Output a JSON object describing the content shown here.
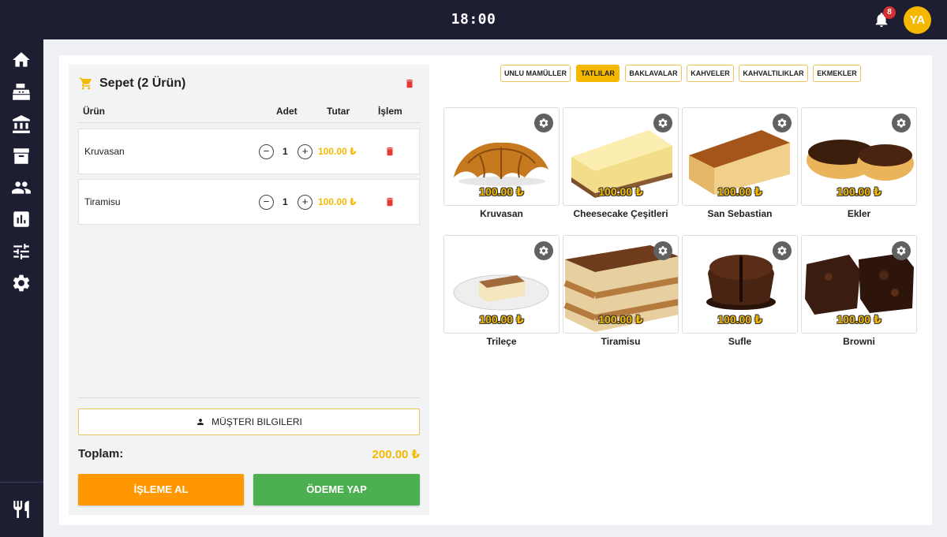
{
  "topbar": {
    "time": "18:00",
    "notification_count": "8",
    "avatar_initials": "YA"
  },
  "sidebar": {
    "items": [
      "home-icon",
      "cash-register-icon",
      "bank-icon",
      "archive-icon",
      "people-icon",
      "bar-chart-icon",
      "sliders-icon",
      "gear-icon"
    ],
    "bottom": "restaurant-icon"
  },
  "cart": {
    "title": "Sepet (2 Ürün)",
    "columns": {
      "product": "Ürün",
      "qty": "Adet",
      "amount": "Tutar",
      "action": "İşlem"
    },
    "items": [
      {
        "name": "Kruvasan",
        "qty": "1",
        "price": "100.00 ₺"
      },
      {
        "name": "Tiramisu",
        "qty": "1",
        "price": "100.00 ₺"
      }
    ],
    "customer_button": "MÜŞTERI BILGILERI",
    "total_label": "Toplam:",
    "total_value": "200.00 ₺",
    "process_button": "İŞLEME AL",
    "pay_button": "ÖDEME YAP"
  },
  "categories": [
    {
      "label": "UNLU MAMÜLLER",
      "active": false
    },
    {
      "label": "TATLILAR",
      "active": true
    },
    {
      "label": "BAKLAVALAR",
      "active": false
    },
    {
      "label": "KAHVELER",
      "active": false
    },
    {
      "label": "KAHVALTILIKLAR",
      "active": false
    },
    {
      "label": "EKMEKLER",
      "active": false
    }
  ],
  "products": [
    {
      "name": "Kruvasan",
      "price": "100.00 ₺"
    },
    {
      "name": "Cheesecake Çeşitleri",
      "price": "100.00 ₺"
    },
    {
      "name": "San Sebastian",
      "price": "100.00 ₺"
    },
    {
      "name": "Ekler",
      "price": "100.00 ₺"
    },
    {
      "name": "Trileçe",
      "price": "100.00 ₺"
    },
    {
      "name": "Tiramisu",
      "price": "100.00 ₺"
    },
    {
      "name": "Sufle",
      "price": "100.00 ₺"
    },
    {
      "name": "Browni",
      "price": "100.00 ₺"
    }
  ],
  "colors": {
    "accent": "#f5b800",
    "dark": "#1e1e33",
    "orange": "#ff9800",
    "green": "#4caf50",
    "danger": "#e53935"
  }
}
